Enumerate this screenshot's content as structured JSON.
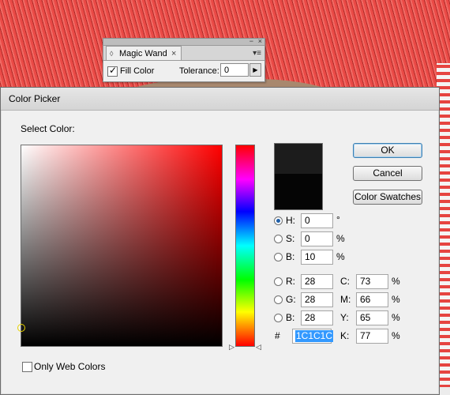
{
  "magic_wand": {
    "tab_label": "Magic Wand",
    "close": "×",
    "fill_color": {
      "label": "Fill Color",
      "checked": true
    },
    "tolerance": {
      "label": "Tolerance:",
      "value": "0"
    }
  },
  "dialog": {
    "title": "Color Picker",
    "select_label": "Select Color:",
    "new_color": "#1c1c1c",
    "current_color": "#050505",
    "buttons": {
      "ok": "OK",
      "cancel": "Cancel",
      "swatches": "Color Swatches"
    },
    "hsb": {
      "h": {
        "label": "H:",
        "value": "0",
        "unit": "°",
        "selected": true
      },
      "s": {
        "label": "S:",
        "value": "0",
        "unit": "%"
      },
      "b": {
        "label": "B:",
        "value": "10",
        "unit": "%"
      }
    },
    "rgb": {
      "r": {
        "label": "R:",
        "value": "28"
      },
      "g": {
        "label": "G:",
        "value": "28"
      },
      "b": {
        "label": "B:",
        "value": "28"
      }
    },
    "cmyk": {
      "c": {
        "label": "C:",
        "value": "73",
        "unit": "%"
      },
      "m": {
        "label": "M:",
        "value": "66",
        "unit": "%"
      },
      "y": {
        "label": "Y:",
        "value": "65",
        "unit": "%"
      },
      "k": {
        "label": "K:",
        "value": "77",
        "unit": "%"
      }
    },
    "hex": {
      "label": "#",
      "value": "1C1C1C"
    },
    "only_web_colors": {
      "label": "Only Web Colors",
      "checked": false
    }
  }
}
